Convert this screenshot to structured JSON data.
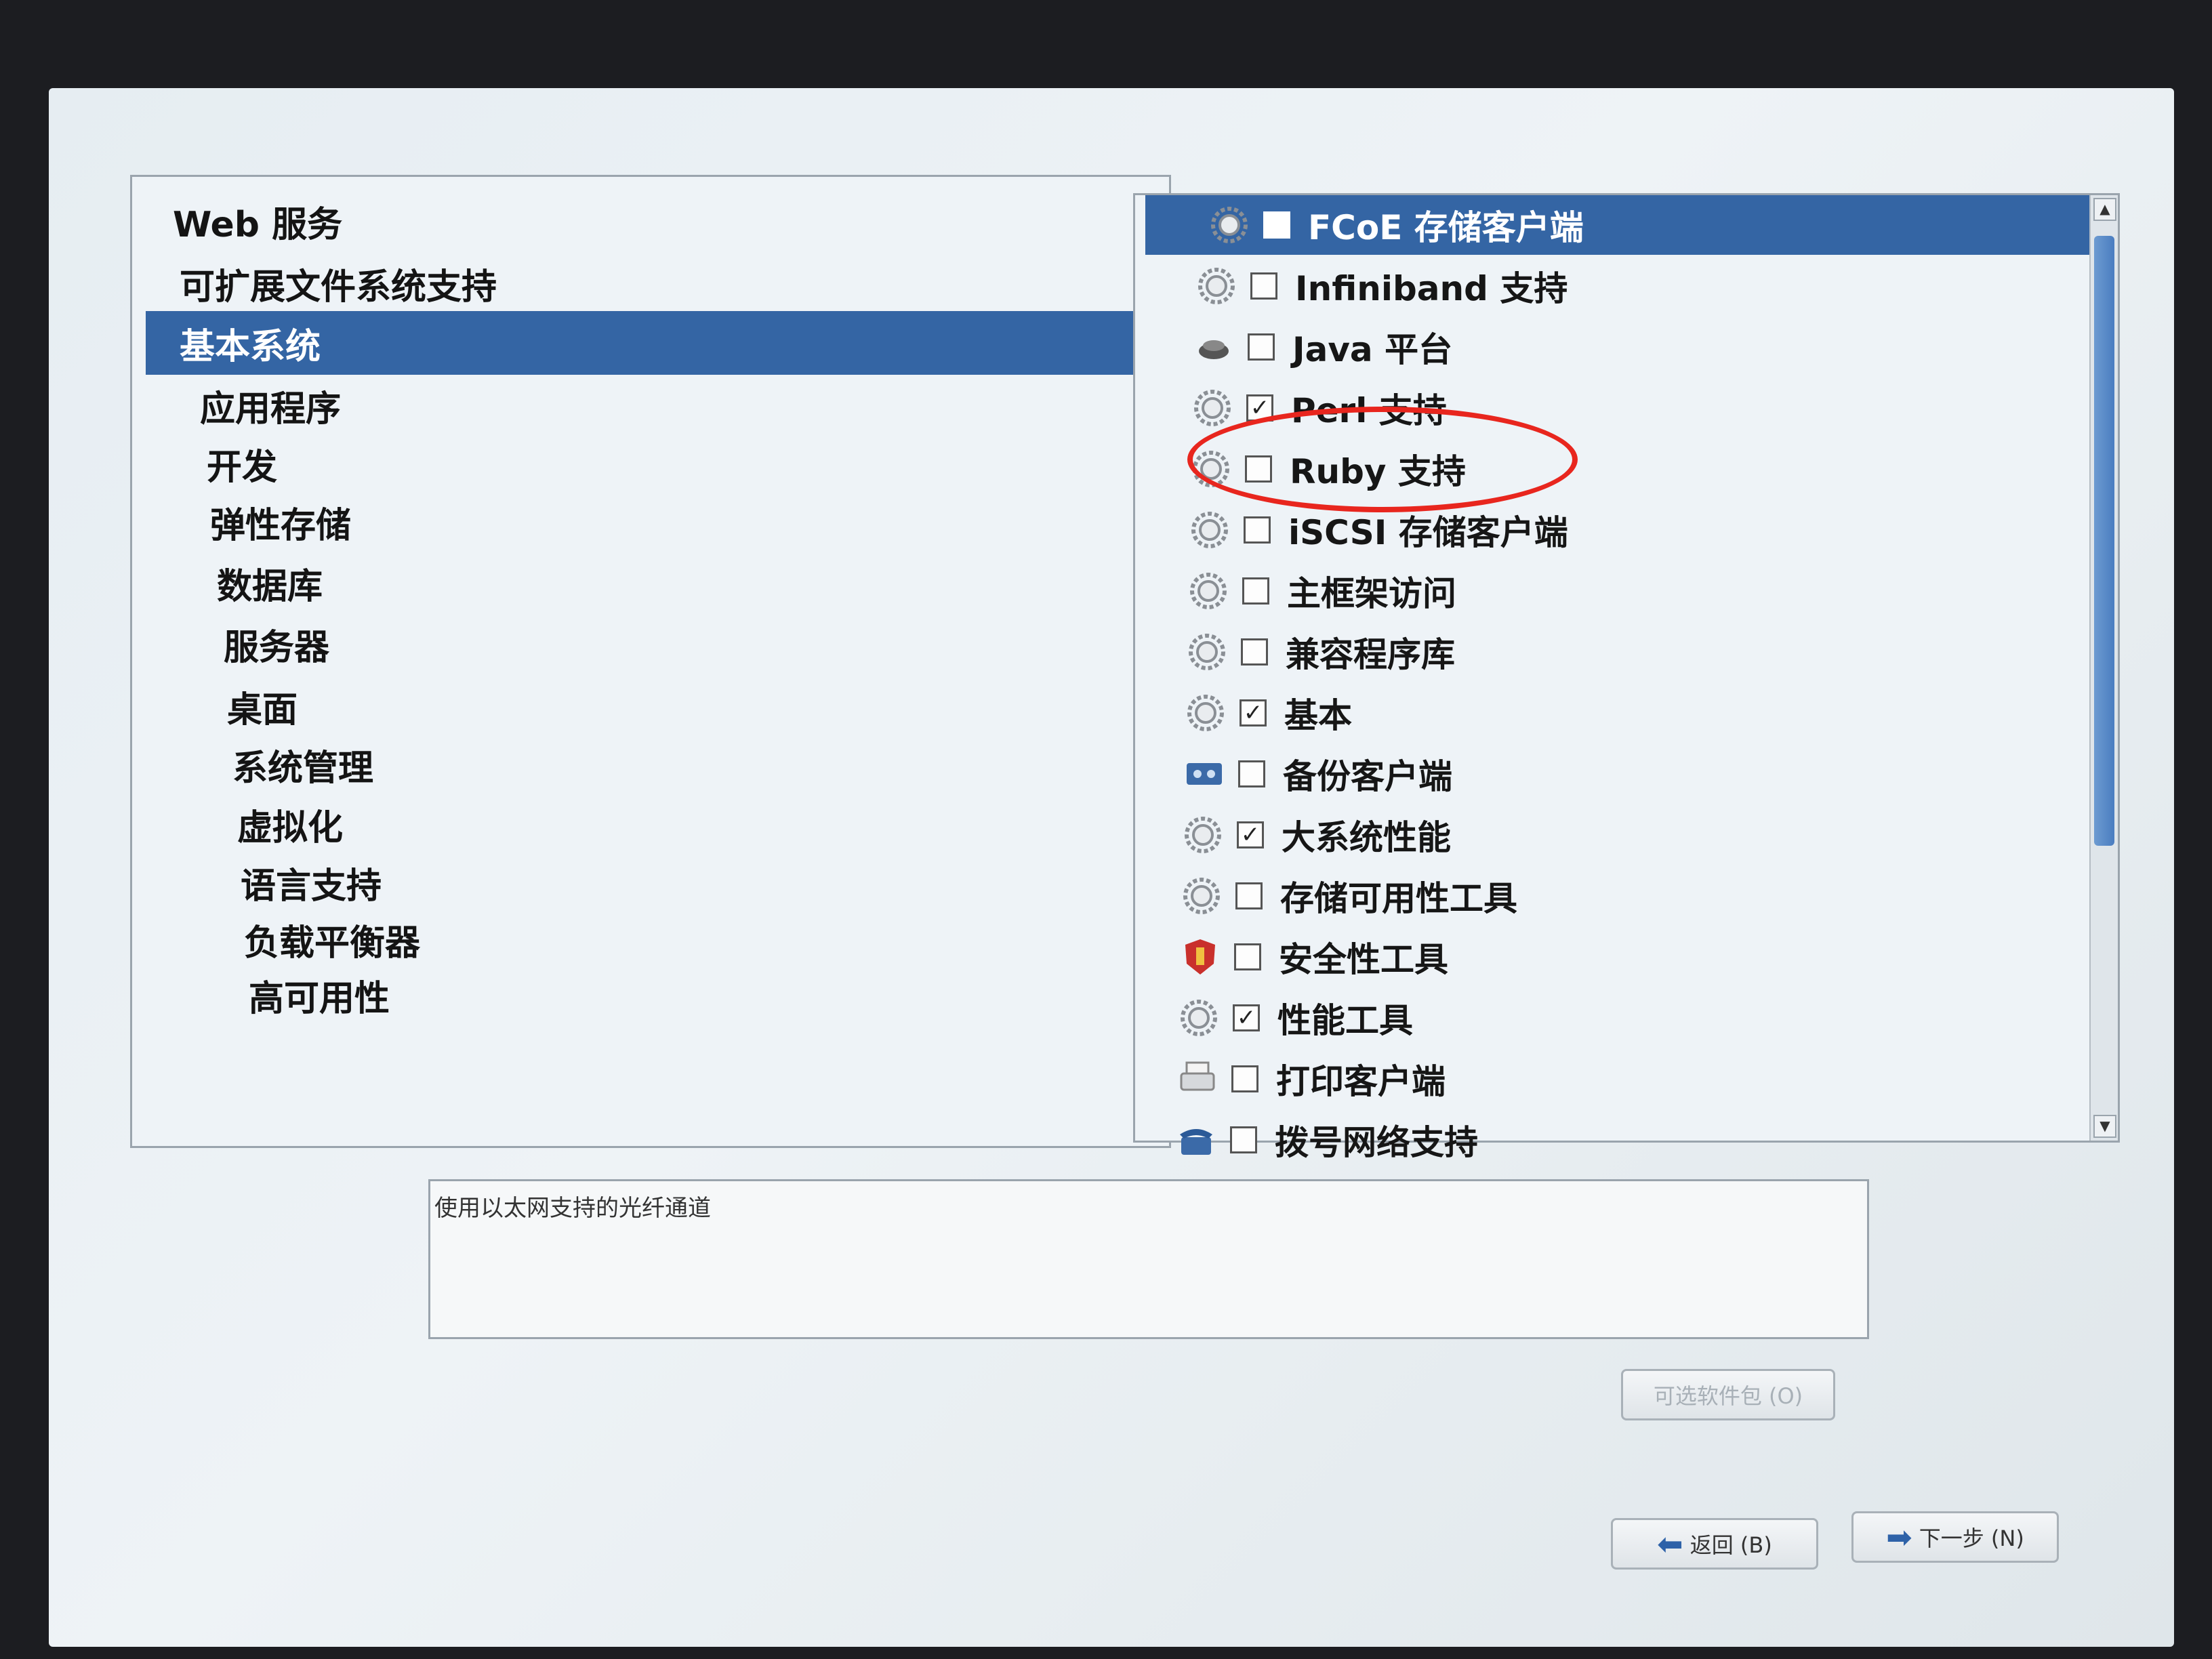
{
  "categories": [
    {
      "label": "Web 服务",
      "selected": false
    },
    {
      "label": "可扩展文件系统支持",
      "selected": false
    },
    {
      "label": "基本系统",
      "selected": true
    },
    {
      "label": "应用程序",
      "selected": false
    },
    {
      "label": "开发",
      "selected": false
    },
    {
      "label": "弹性存储",
      "selected": false
    },
    {
      "label": "数据库",
      "selected": false
    },
    {
      "label": "服务器",
      "selected": false
    },
    {
      "label": "桌面",
      "selected": false
    },
    {
      "label": "系统管理",
      "selected": false
    },
    {
      "label": "虚拟化",
      "selected": false
    },
    {
      "label": "语言支持",
      "selected": false
    },
    {
      "label": "负载平衡器",
      "selected": false
    },
    {
      "label": "高可用性",
      "selected": false
    }
  ],
  "packages": [
    {
      "label": "FCoE 存储客户端",
      "checked": false,
      "selected": true,
      "icon": "gear-icon"
    },
    {
      "label": "Infiniband 支持",
      "checked": false,
      "selected": false,
      "icon": "gear-icon"
    },
    {
      "label": "Java 平台",
      "checked": false,
      "selected": false,
      "icon": "java-icon"
    },
    {
      "label": "Perl 支持",
      "checked": true,
      "selected": false,
      "icon": "gear-icon"
    },
    {
      "label": "Ruby 支持",
      "checked": false,
      "selected": false,
      "icon": "gear-icon"
    },
    {
      "label": "iSCSI 存储客户端",
      "checked": false,
      "selected": false,
      "icon": "gear-icon"
    },
    {
      "label": "主框架访问",
      "checked": false,
      "selected": false,
      "icon": "gear-icon"
    },
    {
      "label": "兼容程序库",
      "checked": false,
      "selected": false,
      "icon": "gear-icon"
    },
    {
      "label": "基本",
      "checked": true,
      "selected": false,
      "icon": "gear-icon"
    },
    {
      "label": "备份客户端",
      "checked": false,
      "selected": false,
      "icon": "tape-icon"
    },
    {
      "label": "大系统性能",
      "checked": true,
      "selected": false,
      "icon": "gear-icon"
    },
    {
      "label": "存储可用性工具",
      "checked": false,
      "selected": false,
      "icon": "gear-icon"
    },
    {
      "label": "安全性工具",
      "checked": false,
      "selected": false,
      "icon": "shield-icon"
    },
    {
      "label": "性能工具",
      "checked": true,
      "selected": false,
      "icon": "gear-icon"
    },
    {
      "label": "打印客户端",
      "checked": false,
      "selected": false,
      "icon": "printer-icon"
    },
    {
      "label": "拨号网络支持",
      "checked": false,
      "selected": false,
      "icon": "phone-icon"
    }
  ],
  "description": "使用以太网支持的光纤通道",
  "buttons": {
    "optional": "可选软件包 (O)",
    "back": "返回 (B)",
    "next": "下一步 (N)"
  }
}
